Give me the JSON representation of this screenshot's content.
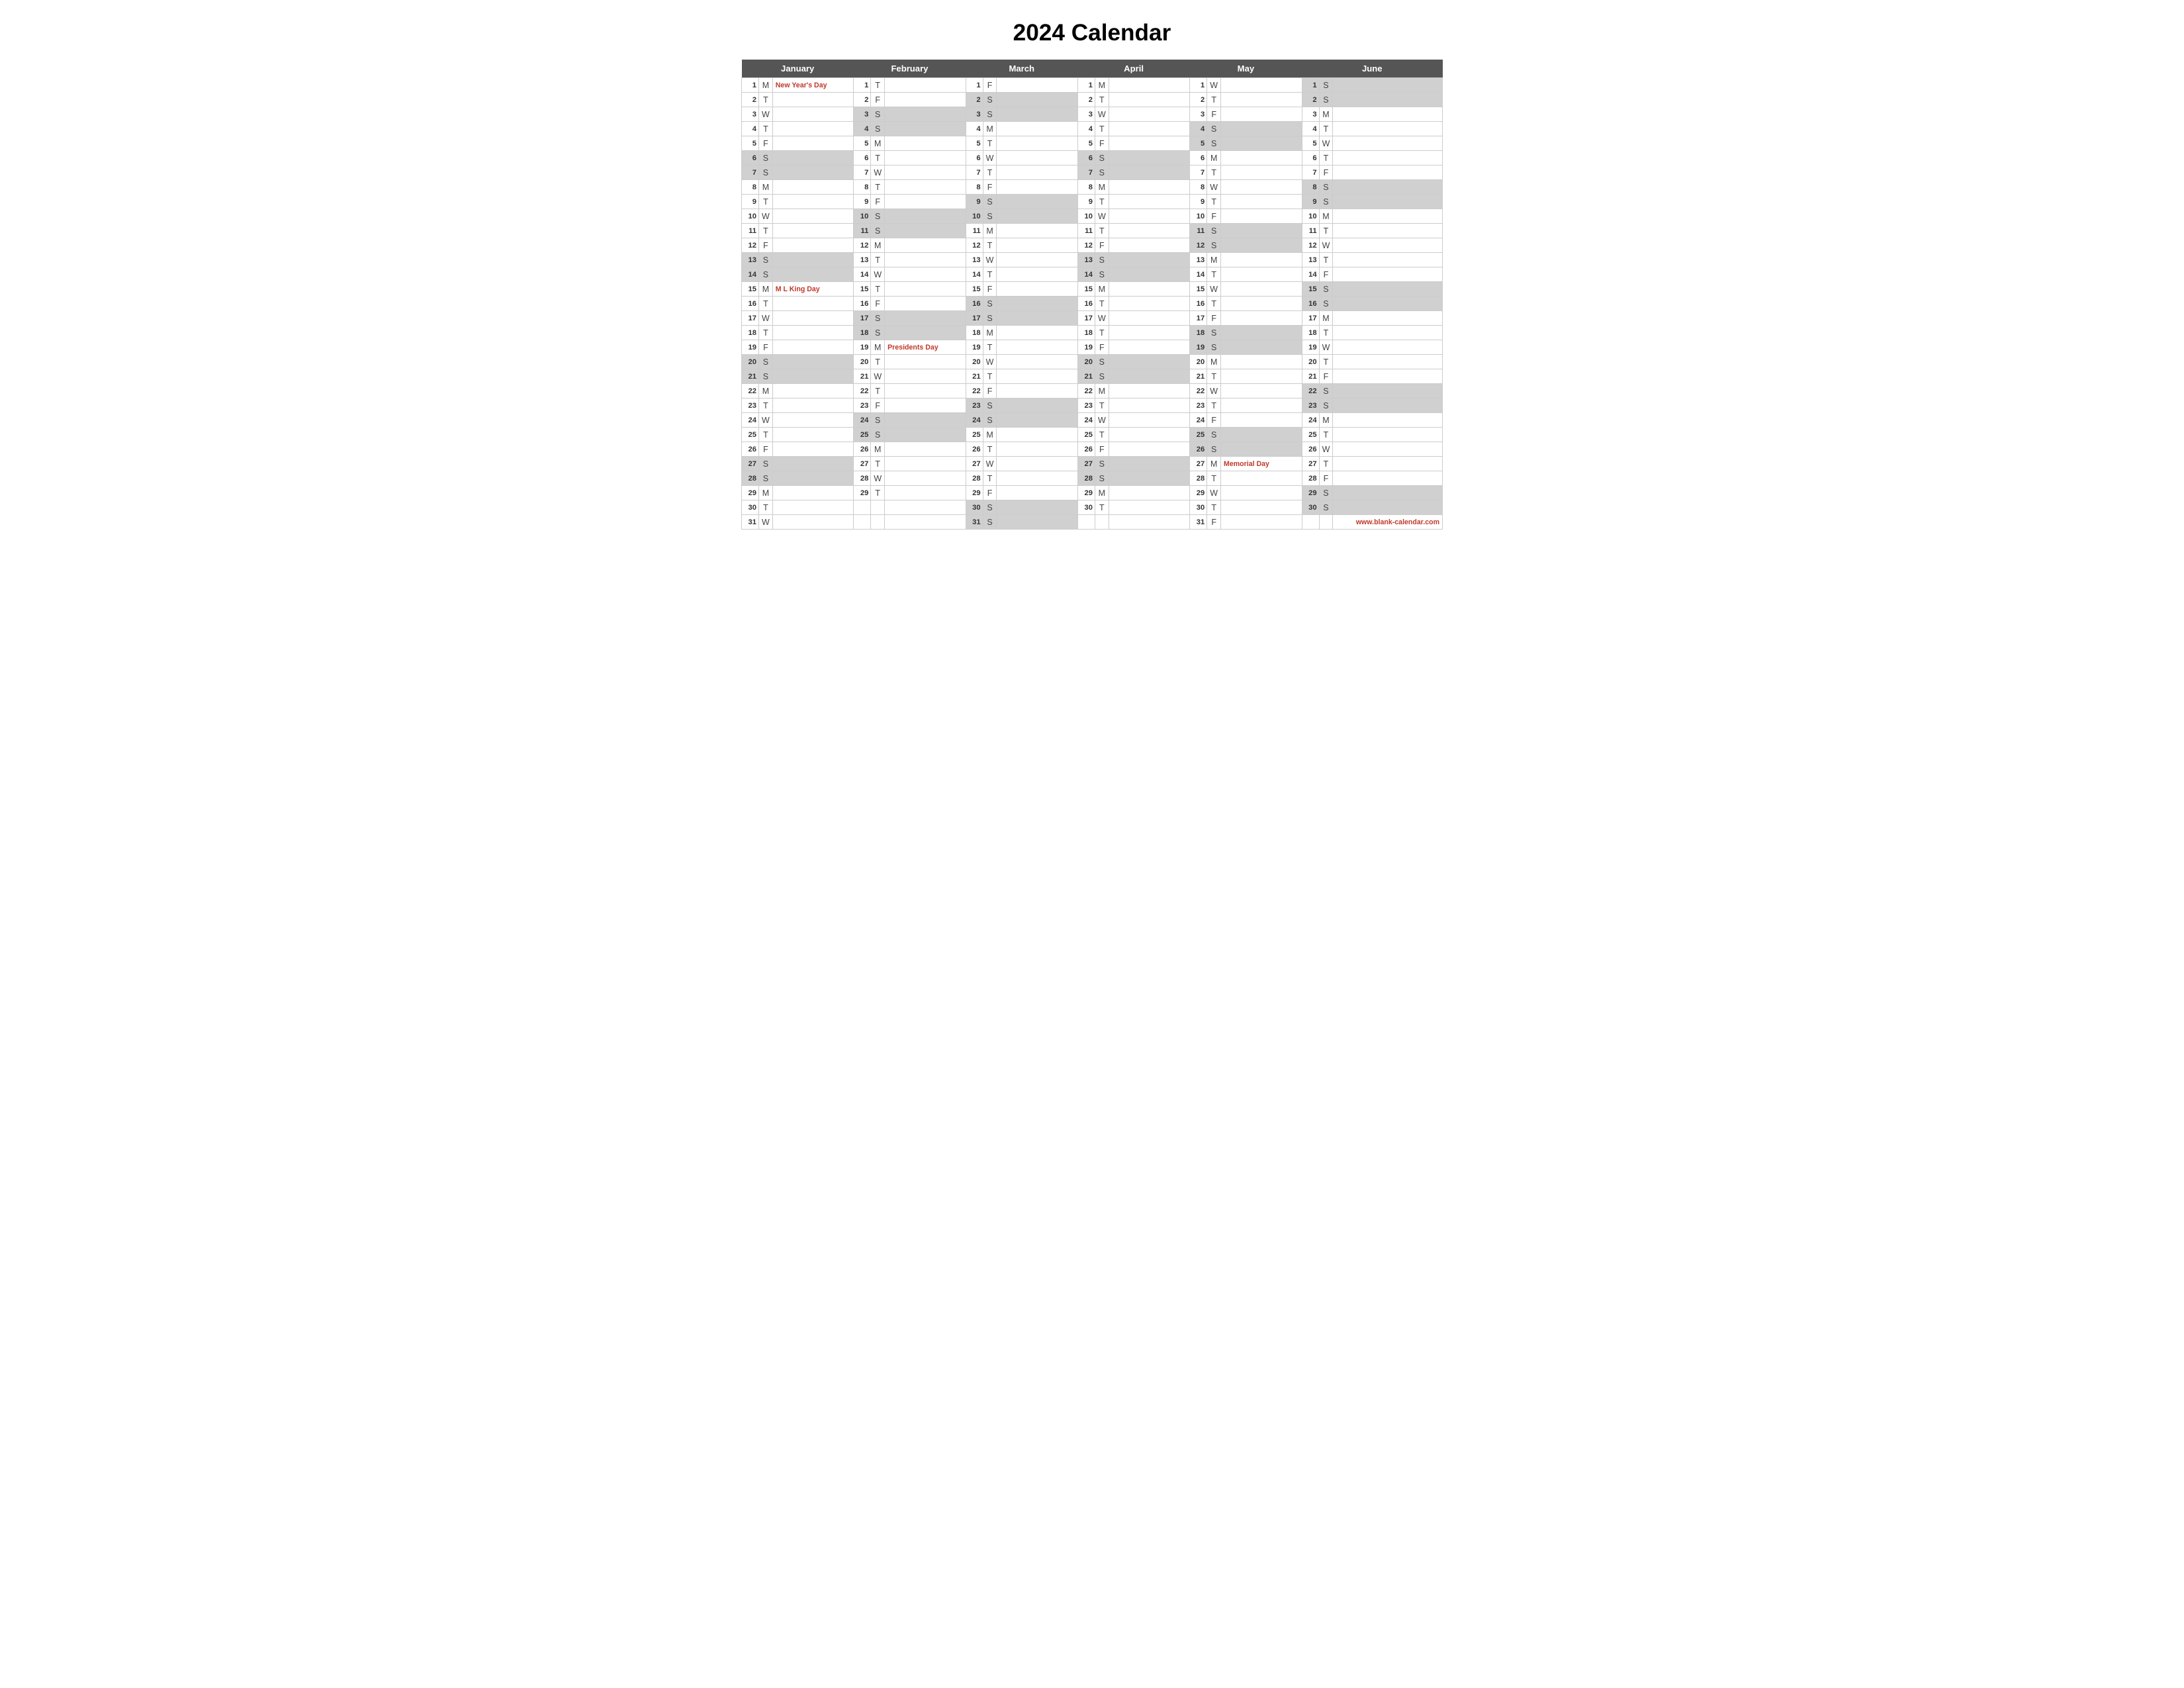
{
  "title": "2024 Calendar",
  "website": "www.blank-calendar.com",
  "months": [
    "January",
    "February",
    "March",
    "April",
    "May",
    "June"
  ],
  "days": {
    "jan": [
      {
        "d": 1,
        "w": "M",
        "h": "New Year's Day",
        "shade": false
      },
      {
        "d": 2,
        "w": "T",
        "h": "",
        "shade": false
      },
      {
        "d": 3,
        "w": "W",
        "h": "",
        "shade": false
      },
      {
        "d": 4,
        "w": "T",
        "h": "",
        "shade": false
      },
      {
        "d": 5,
        "w": "F",
        "h": "",
        "shade": false
      },
      {
        "d": 6,
        "w": "S",
        "h": "",
        "shade": true
      },
      {
        "d": 7,
        "w": "S",
        "h": "",
        "shade": true
      },
      {
        "d": 8,
        "w": "M",
        "h": "",
        "shade": false
      },
      {
        "d": 9,
        "w": "T",
        "h": "",
        "shade": false
      },
      {
        "d": 10,
        "w": "W",
        "h": "",
        "shade": false
      },
      {
        "d": 11,
        "w": "T",
        "h": "",
        "shade": false
      },
      {
        "d": 12,
        "w": "F",
        "h": "",
        "shade": false
      },
      {
        "d": 13,
        "w": "S",
        "h": "",
        "shade": true
      },
      {
        "d": 14,
        "w": "S",
        "h": "",
        "shade": true
      },
      {
        "d": 15,
        "w": "M",
        "h": "M L King Day",
        "shade": false
      },
      {
        "d": 16,
        "w": "T",
        "h": "",
        "shade": false
      },
      {
        "d": 17,
        "w": "W",
        "h": "",
        "shade": false
      },
      {
        "d": 18,
        "w": "T",
        "h": "",
        "shade": false
      },
      {
        "d": 19,
        "w": "F",
        "h": "",
        "shade": false
      },
      {
        "d": 20,
        "w": "S",
        "h": "",
        "shade": true
      },
      {
        "d": 21,
        "w": "S",
        "h": "",
        "shade": true
      },
      {
        "d": 22,
        "w": "M",
        "h": "",
        "shade": false
      },
      {
        "d": 23,
        "w": "T",
        "h": "",
        "shade": false
      },
      {
        "d": 24,
        "w": "W",
        "h": "",
        "shade": false
      },
      {
        "d": 25,
        "w": "T",
        "h": "",
        "shade": false
      },
      {
        "d": 26,
        "w": "F",
        "h": "",
        "shade": false
      },
      {
        "d": 27,
        "w": "S",
        "h": "",
        "shade": true
      },
      {
        "d": 28,
        "w": "S",
        "h": "",
        "shade": true
      },
      {
        "d": 29,
        "w": "M",
        "h": "",
        "shade": false
      },
      {
        "d": 30,
        "w": "T",
        "h": "",
        "shade": false
      },
      {
        "d": 31,
        "w": "W",
        "h": "",
        "shade": false
      }
    ],
    "feb": [
      {
        "d": 1,
        "w": "T",
        "h": "",
        "shade": false
      },
      {
        "d": 2,
        "w": "F",
        "h": "",
        "shade": false
      },
      {
        "d": 3,
        "w": "S",
        "h": "",
        "shade": true
      },
      {
        "d": 4,
        "w": "S",
        "h": "",
        "shade": true
      },
      {
        "d": 5,
        "w": "M",
        "h": "",
        "shade": false
      },
      {
        "d": 6,
        "w": "T",
        "h": "",
        "shade": false
      },
      {
        "d": 7,
        "w": "W",
        "h": "",
        "shade": false
      },
      {
        "d": 8,
        "w": "T",
        "h": "",
        "shade": false
      },
      {
        "d": 9,
        "w": "F",
        "h": "",
        "shade": false
      },
      {
        "d": 10,
        "w": "S",
        "h": "",
        "shade": true
      },
      {
        "d": 11,
        "w": "S",
        "h": "",
        "shade": true
      },
      {
        "d": 12,
        "w": "M",
        "h": "",
        "shade": false
      },
      {
        "d": 13,
        "w": "T",
        "h": "",
        "shade": false
      },
      {
        "d": 14,
        "w": "W",
        "h": "",
        "shade": false
      },
      {
        "d": 15,
        "w": "T",
        "h": "",
        "shade": false
      },
      {
        "d": 16,
        "w": "F",
        "h": "",
        "shade": false
      },
      {
        "d": 17,
        "w": "S",
        "h": "",
        "shade": true
      },
      {
        "d": 18,
        "w": "S",
        "h": "",
        "shade": true
      },
      {
        "d": 19,
        "w": "M",
        "h": "Presidents Day",
        "shade": false
      },
      {
        "d": 20,
        "w": "T",
        "h": "",
        "shade": false
      },
      {
        "d": 21,
        "w": "W",
        "h": "",
        "shade": false
      },
      {
        "d": 22,
        "w": "T",
        "h": "",
        "shade": false
      },
      {
        "d": 23,
        "w": "F",
        "h": "",
        "shade": false
      },
      {
        "d": 24,
        "w": "S",
        "h": "",
        "shade": true
      },
      {
        "d": 25,
        "w": "S",
        "h": "",
        "shade": true
      },
      {
        "d": 26,
        "w": "M",
        "h": "",
        "shade": false
      },
      {
        "d": 27,
        "w": "T",
        "h": "",
        "shade": false
      },
      {
        "d": 28,
        "w": "W",
        "h": "",
        "shade": false
      },
      {
        "d": 29,
        "w": "T",
        "h": "",
        "shade": false
      }
    ],
    "mar": [
      {
        "d": 1,
        "w": "F",
        "h": "",
        "shade": false
      },
      {
        "d": 2,
        "w": "S",
        "h": "",
        "shade": true
      },
      {
        "d": 3,
        "w": "S",
        "h": "",
        "shade": true
      },
      {
        "d": 4,
        "w": "M",
        "h": "",
        "shade": false
      },
      {
        "d": 5,
        "w": "T",
        "h": "",
        "shade": false
      },
      {
        "d": 6,
        "w": "W",
        "h": "",
        "shade": false
      },
      {
        "d": 7,
        "w": "T",
        "h": "",
        "shade": false
      },
      {
        "d": 8,
        "w": "F",
        "h": "",
        "shade": false
      },
      {
        "d": 9,
        "w": "S",
        "h": "",
        "shade": true
      },
      {
        "d": 10,
        "w": "S",
        "h": "",
        "shade": true
      },
      {
        "d": 11,
        "w": "M",
        "h": "",
        "shade": false
      },
      {
        "d": 12,
        "w": "T",
        "h": "",
        "shade": false
      },
      {
        "d": 13,
        "w": "W",
        "h": "",
        "shade": false
      },
      {
        "d": 14,
        "w": "T",
        "h": "",
        "shade": false
      },
      {
        "d": 15,
        "w": "F",
        "h": "",
        "shade": false
      },
      {
        "d": 16,
        "w": "S",
        "h": "",
        "shade": true
      },
      {
        "d": 17,
        "w": "S",
        "h": "",
        "shade": true
      },
      {
        "d": 18,
        "w": "M",
        "h": "",
        "shade": false
      },
      {
        "d": 19,
        "w": "T",
        "h": "",
        "shade": false
      },
      {
        "d": 20,
        "w": "W",
        "h": "",
        "shade": false
      },
      {
        "d": 21,
        "w": "T",
        "h": "",
        "shade": false
      },
      {
        "d": 22,
        "w": "F",
        "h": "",
        "shade": false
      },
      {
        "d": 23,
        "w": "S",
        "h": "",
        "shade": true
      },
      {
        "d": 24,
        "w": "S",
        "h": "",
        "shade": true
      },
      {
        "d": 25,
        "w": "M",
        "h": "",
        "shade": false
      },
      {
        "d": 26,
        "w": "T",
        "h": "",
        "shade": false
      },
      {
        "d": 27,
        "w": "W",
        "h": "",
        "shade": false
      },
      {
        "d": 28,
        "w": "T",
        "h": "",
        "shade": false
      },
      {
        "d": 29,
        "w": "F",
        "h": "",
        "shade": false
      },
      {
        "d": 30,
        "w": "S",
        "h": "",
        "shade": true
      },
      {
        "d": 31,
        "w": "S",
        "h": "",
        "shade": true
      }
    ],
    "apr": [
      {
        "d": 1,
        "w": "M",
        "h": "",
        "shade": false
      },
      {
        "d": 2,
        "w": "T",
        "h": "",
        "shade": false
      },
      {
        "d": 3,
        "w": "W",
        "h": "",
        "shade": false
      },
      {
        "d": 4,
        "w": "T",
        "h": "",
        "shade": false
      },
      {
        "d": 5,
        "w": "F",
        "h": "",
        "shade": false
      },
      {
        "d": 6,
        "w": "S",
        "h": "",
        "shade": true
      },
      {
        "d": 7,
        "w": "S",
        "h": "",
        "shade": true
      },
      {
        "d": 8,
        "w": "M",
        "h": "",
        "shade": false
      },
      {
        "d": 9,
        "w": "T",
        "h": "",
        "shade": false
      },
      {
        "d": 10,
        "w": "W",
        "h": "",
        "shade": false
      },
      {
        "d": 11,
        "w": "T",
        "h": "",
        "shade": false
      },
      {
        "d": 12,
        "w": "F",
        "h": "",
        "shade": false
      },
      {
        "d": 13,
        "w": "S",
        "h": "",
        "shade": true
      },
      {
        "d": 14,
        "w": "S",
        "h": "",
        "shade": true
      },
      {
        "d": 15,
        "w": "M",
        "h": "",
        "shade": false
      },
      {
        "d": 16,
        "w": "T",
        "h": "",
        "shade": false
      },
      {
        "d": 17,
        "w": "W",
        "h": "",
        "shade": false
      },
      {
        "d": 18,
        "w": "T",
        "h": "",
        "shade": false
      },
      {
        "d": 19,
        "w": "F",
        "h": "",
        "shade": false
      },
      {
        "d": 20,
        "w": "S",
        "h": "",
        "shade": true
      },
      {
        "d": 21,
        "w": "S",
        "h": "",
        "shade": true
      },
      {
        "d": 22,
        "w": "M",
        "h": "",
        "shade": false
      },
      {
        "d": 23,
        "w": "T",
        "h": "",
        "shade": false
      },
      {
        "d": 24,
        "w": "W",
        "h": "",
        "shade": false
      },
      {
        "d": 25,
        "w": "T",
        "h": "",
        "shade": false
      },
      {
        "d": 26,
        "w": "F",
        "h": "",
        "shade": false
      },
      {
        "d": 27,
        "w": "S",
        "h": "",
        "shade": true
      },
      {
        "d": 28,
        "w": "S",
        "h": "",
        "shade": true
      },
      {
        "d": 29,
        "w": "M",
        "h": "",
        "shade": false
      },
      {
        "d": 30,
        "w": "T",
        "h": "",
        "shade": false
      }
    ],
    "may": [
      {
        "d": 1,
        "w": "W",
        "h": "",
        "shade": false
      },
      {
        "d": 2,
        "w": "T",
        "h": "",
        "shade": false
      },
      {
        "d": 3,
        "w": "F",
        "h": "",
        "shade": false
      },
      {
        "d": 4,
        "w": "S",
        "h": "",
        "shade": true
      },
      {
        "d": 5,
        "w": "S",
        "h": "",
        "shade": true
      },
      {
        "d": 6,
        "w": "M",
        "h": "",
        "shade": false
      },
      {
        "d": 7,
        "w": "T",
        "h": "",
        "shade": false
      },
      {
        "d": 8,
        "w": "W",
        "h": "",
        "shade": false
      },
      {
        "d": 9,
        "w": "T",
        "h": "",
        "shade": false
      },
      {
        "d": 10,
        "w": "F",
        "h": "",
        "shade": false
      },
      {
        "d": 11,
        "w": "S",
        "h": "",
        "shade": true
      },
      {
        "d": 12,
        "w": "S",
        "h": "",
        "shade": true
      },
      {
        "d": 13,
        "w": "M",
        "h": "",
        "shade": false
      },
      {
        "d": 14,
        "w": "T",
        "h": "",
        "shade": false
      },
      {
        "d": 15,
        "w": "W",
        "h": "",
        "shade": false
      },
      {
        "d": 16,
        "w": "T",
        "h": "",
        "shade": false
      },
      {
        "d": 17,
        "w": "F",
        "h": "",
        "shade": false
      },
      {
        "d": 18,
        "w": "S",
        "h": "",
        "shade": true
      },
      {
        "d": 19,
        "w": "S",
        "h": "",
        "shade": true
      },
      {
        "d": 20,
        "w": "M",
        "h": "",
        "shade": false
      },
      {
        "d": 21,
        "w": "T",
        "h": "",
        "shade": false
      },
      {
        "d": 22,
        "w": "W",
        "h": "",
        "shade": false
      },
      {
        "d": 23,
        "w": "T",
        "h": "",
        "shade": false
      },
      {
        "d": 24,
        "w": "F",
        "h": "",
        "shade": false
      },
      {
        "d": 25,
        "w": "S",
        "h": "",
        "shade": true
      },
      {
        "d": 26,
        "w": "S",
        "h": "",
        "shade": true
      },
      {
        "d": 27,
        "w": "M",
        "h": "Memorial Day",
        "shade": false
      },
      {
        "d": 28,
        "w": "T",
        "h": "",
        "shade": false
      },
      {
        "d": 29,
        "w": "W",
        "h": "",
        "shade": false
      },
      {
        "d": 30,
        "w": "T",
        "h": "",
        "shade": false
      },
      {
        "d": 31,
        "w": "F",
        "h": "",
        "shade": false
      }
    ],
    "jun": [
      {
        "d": 1,
        "w": "S",
        "h": "",
        "shade": true
      },
      {
        "d": 2,
        "w": "S",
        "h": "",
        "shade": true
      },
      {
        "d": 3,
        "w": "M",
        "h": "",
        "shade": false
      },
      {
        "d": 4,
        "w": "T",
        "h": "",
        "shade": false
      },
      {
        "d": 5,
        "w": "W",
        "h": "",
        "shade": false
      },
      {
        "d": 6,
        "w": "T",
        "h": "",
        "shade": false
      },
      {
        "d": 7,
        "w": "F",
        "h": "",
        "shade": false
      },
      {
        "d": 8,
        "w": "S",
        "h": "",
        "shade": true
      },
      {
        "d": 9,
        "w": "S",
        "h": "",
        "shade": true
      },
      {
        "d": 10,
        "w": "M",
        "h": "",
        "shade": false
      },
      {
        "d": 11,
        "w": "T",
        "h": "",
        "shade": false
      },
      {
        "d": 12,
        "w": "W",
        "h": "",
        "shade": false
      },
      {
        "d": 13,
        "w": "T",
        "h": "",
        "shade": false
      },
      {
        "d": 14,
        "w": "F",
        "h": "",
        "shade": false
      },
      {
        "d": 15,
        "w": "S",
        "h": "",
        "shade": true
      },
      {
        "d": 16,
        "w": "S",
        "h": "",
        "shade": true
      },
      {
        "d": 17,
        "w": "M",
        "h": "",
        "shade": false
      },
      {
        "d": 18,
        "w": "T",
        "h": "",
        "shade": false
      },
      {
        "d": 19,
        "w": "W",
        "h": "",
        "shade": false
      },
      {
        "d": 20,
        "w": "T",
        "h": "",
        "shade": false
      },
      {
        "d": 21,
        "w": "F",
        "h": "",
        "shade": false
      },
      {
        "d": 22,
        "w": "S",
        "h": "",
        "shade": true
      },
      {
        "d": 23,
        "w": "S",
        "h": "",
        "shade": true
      },
      {
        "d": 24,
        "w": "M",
        "h": "",
        "shade": false
      },
      {
        "d": 25,
        "w": "T",
        "h": "",
        "shade": false
      },
      {
        "d": 26,
        "w": "W",
        "h": "",
        "shade": false
      },
      {
        "d": 27,
        "w": "T",
        "h": "",
        "shade": false
      },
      {
        "d": 28,
        "w": "F",
        "h": "",
        "shade": false
      },
      {
        "d": 29,
        "w": "S",
        "h": "",
        "shade": true
      },
      {
        "d": 30,
        "w": "S",
        "h": "",
        "shade": true
      }
    ]
  }
}
